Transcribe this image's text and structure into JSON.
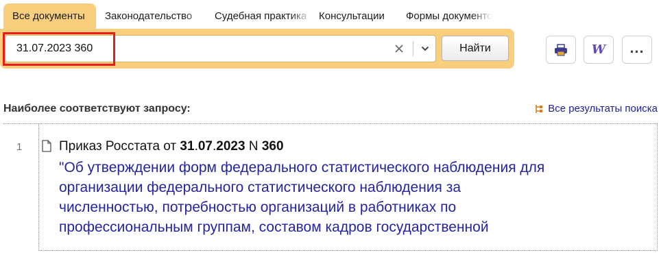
{
  "tabs": [
    {
      "label": "Все документы",
      "active": true
    },
    {
      "label": "Законодательство",
      "active": false
    },
    {
      "label": "Судебная практика",
      "active": false
    },
    {
      "label": "Консультации",
      "active": false
    },
    {
      "label": "Формы документов",
      "active": false
    }
  ],
  "search": {
    "value": "31.07.2023 360",
    "find_label": "Найти",
    "clear_icon": "close-icon",
    "dropdown_icon": "chevron-down-icon"
  },
  "toolbar": {
    "print_icon": "printer-icon",
    "word_label": "W",
    "more_label": "..."
  },
  "results": {
    "heading": "Наиболее соответствуют запросу:",
    "all_results_label": "Все результаты поиска",
    "items": [
      {
        "number": "1",
        "title_prefix": "Приказ Росстата от ",
        "title_bold1": "31",
        "dot1": ".",
        "title_bold2": "07",
        "dot2": ".",
        "title_bold3": "2023",
        "title_mid": " N ",
        "title_bold4": "360",
        "desc_lines": [
          "\"Об утверждении форм федерального статистического наблюдения для",
          "организации федерального статистического наблюдения за",
          "численностью, потребностью организаций в работниках по",
          "профессиональным группам, составом кадров государственной"
        ]
      }
    ]
  },
  "colors": {
    "accent": "#f9cf7d",
    "highlight": "#e51d1d",
    "link": "#2424a3"
  }
}
